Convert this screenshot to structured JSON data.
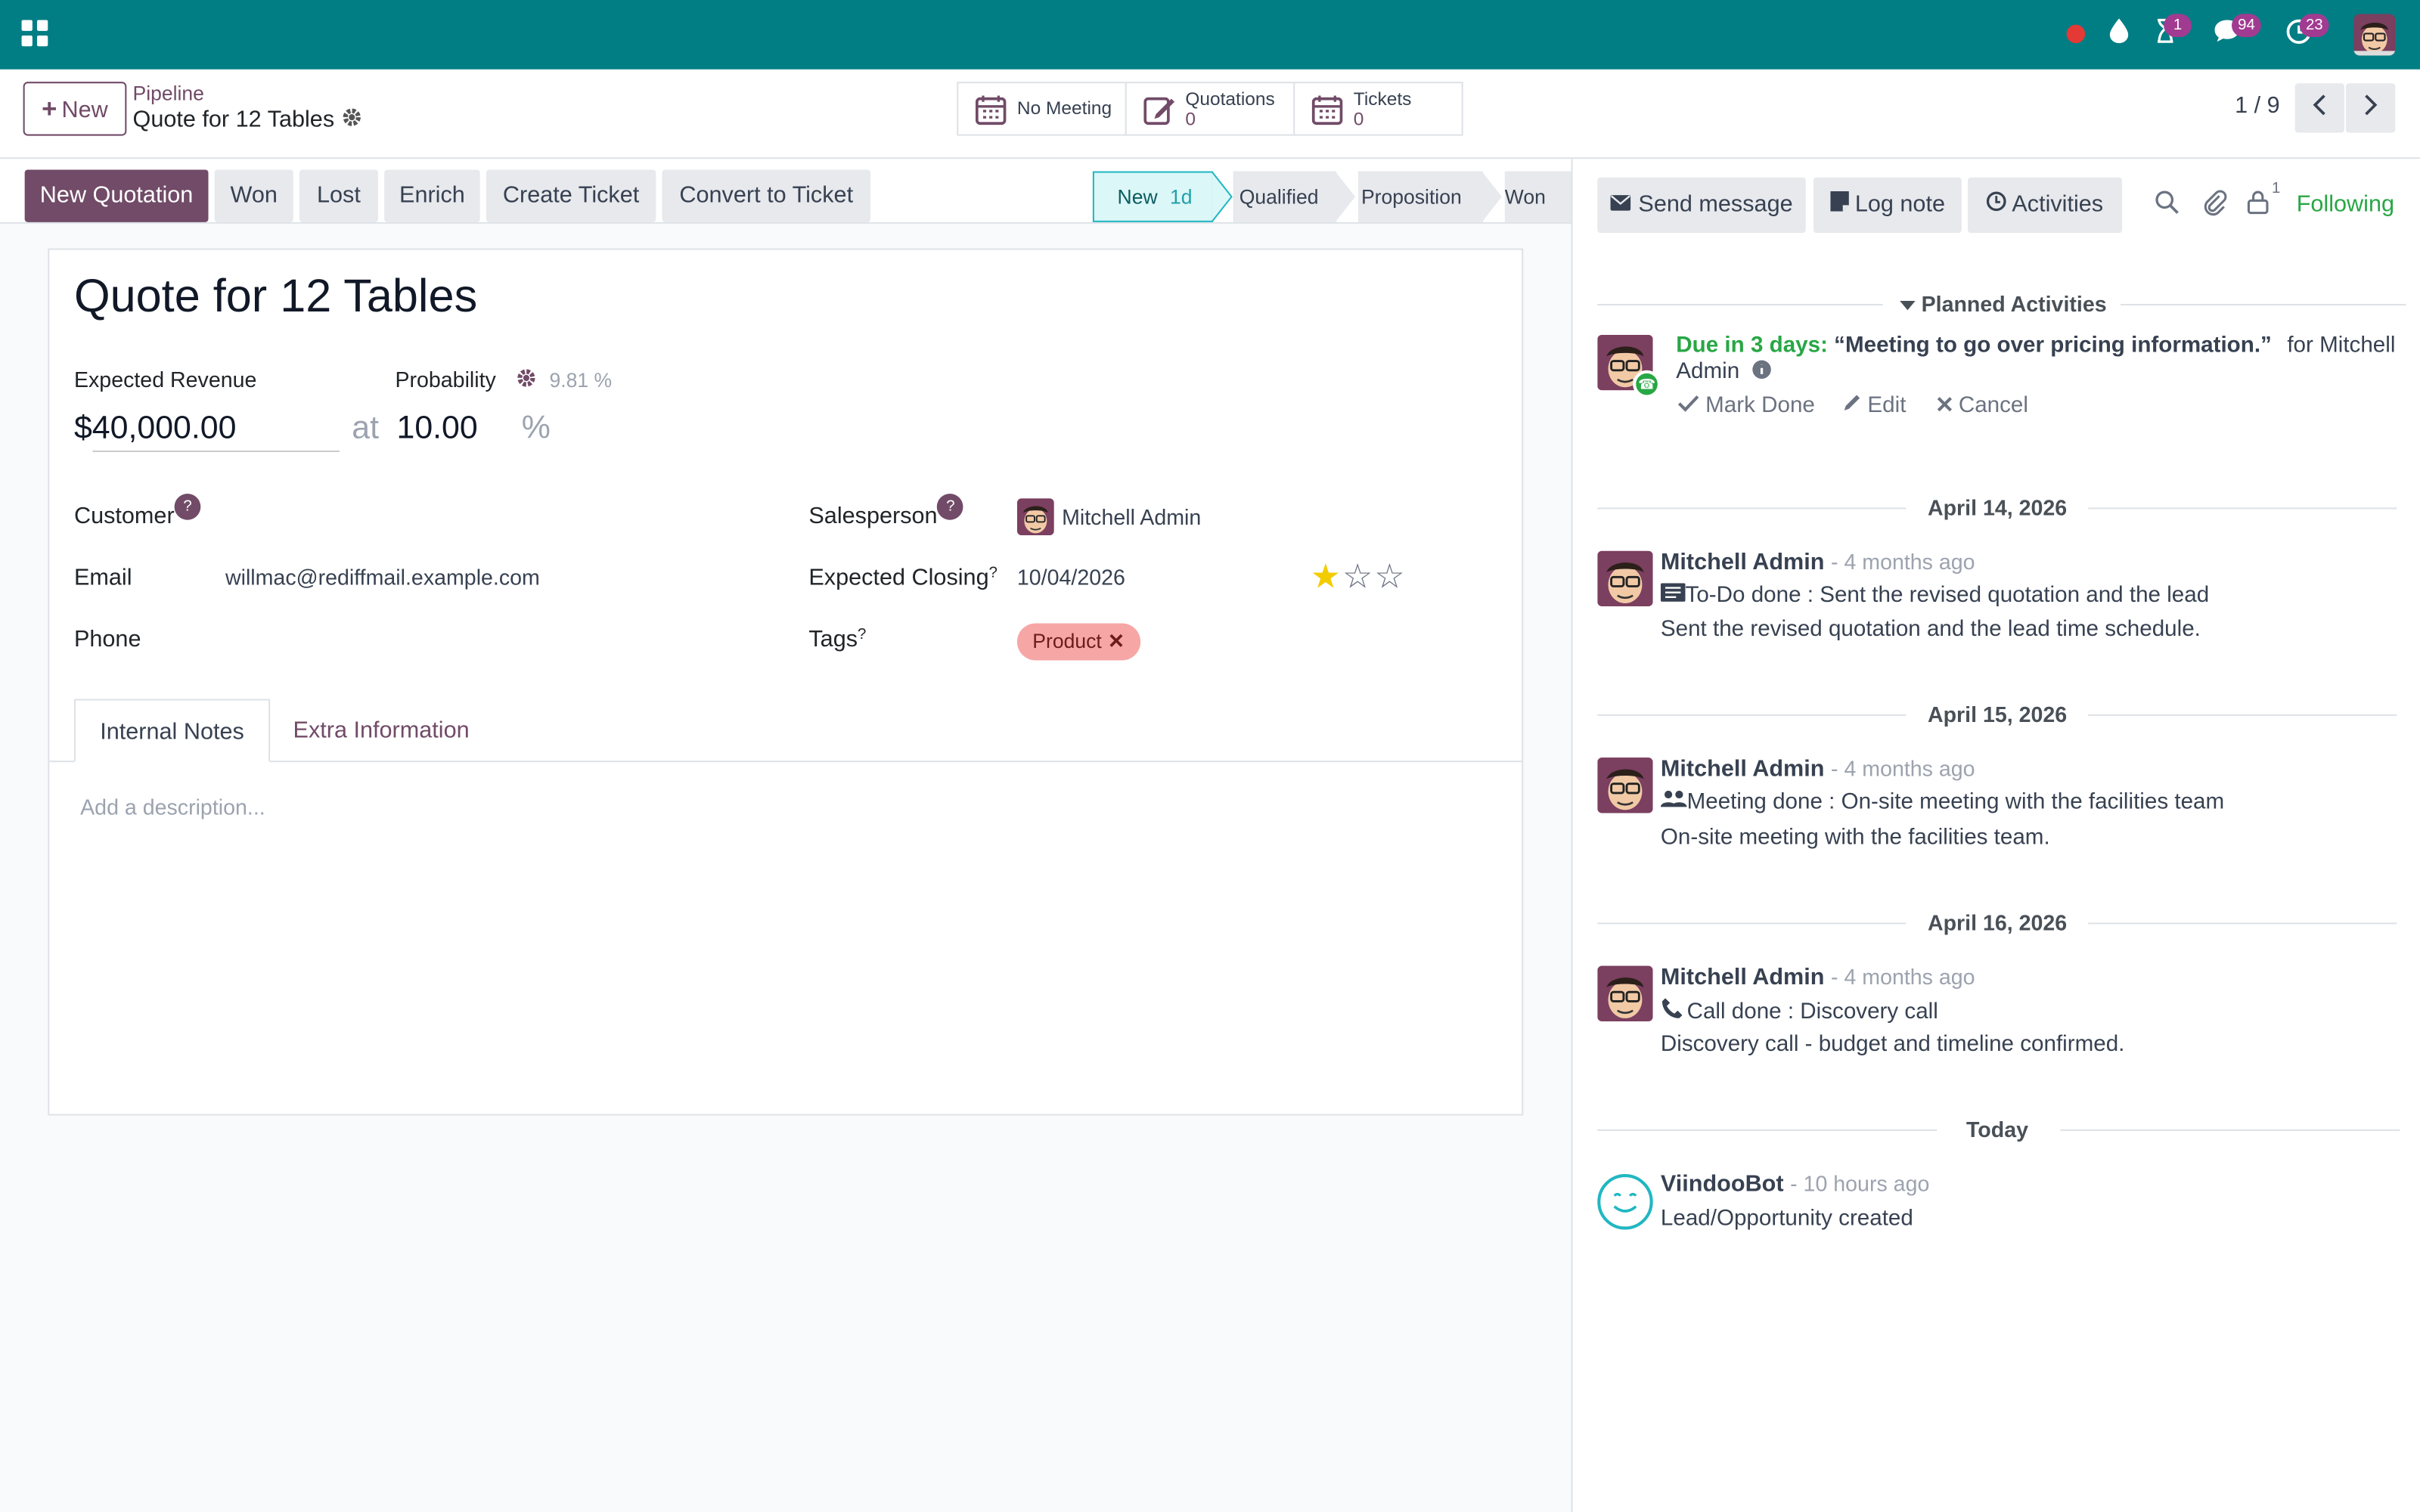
{
  "topbar": {
    "activity_count": "1",
    "messages_count": "94",
    "clock_count": "23"
  },
  "control_panel": {
    "new_label": "New",
    "breadcrumb_parent": "Pipeline",
    "breadcrumb_current": "Quote for 12 Tables",
    "smart_buttons": [
      {
        "label": "No Meeting",
        "value": ""
      },
      {
        "label": "Quotations",
        "value": "0"
      },
      {
        "label": "Tickets",
        "value": "0"
      }
    ],
    "pager": "1 / 9"
  },
  "actions": {
    "new_quotation": "New Quotation",
    "won": "Won",
    "lost": "Lost",
    "enrich": "Enrich",
    "create_ticket": "Create Ticket",
    "convert_to_ticket": "Convert to Ticket"
  },
  "stages": {
    "items": [
      "New",
      "Qualified",
      "Proposition",
      "Won"
    ],
    "active_duration": "1d",
    "active": "New"
  },
  "form": {
    "title": "Quote for 12 Tables",
    "expected_revenue_label": "Expected Revenue",
    "probability_label": "Probability",
    "probability_auto": "9.81 %",
    "expected_revenue": "$40,000.00",
    "at_label": "at",
    "probability_value": "10.00",
    "percent_sign": "%",
    "customer_label": "Customer",
    "email_label": "Email",
    "email_value": "willmac@rediffmail.example.com",
    "phone_label": "Phone",
    "salesperson_label": "Salesperson",
    "salesperson_value": "Mitchell Admin",
    "expected_closing_label": "Expected Closing",
    "expected_closing_value": "10/04/2026",
    "priority_stars": 1,
    "tags_label": "Tags",
    "tag_value": "Product",
    "tabs": [
      "Internal Notes",
      "Extra Information"
    ],
    "description_placeholder": "Add a description..."
  },
  "chatter": {
    "send_message": "Send message",
    "log_note": "Log note",
    "activities": "Activities",
    "follower_count": "1",
    "following": "Following",
    "planned_activities": "Planned Activities",
    "planned": {
      "due": "Due in 3 days:",
      "summary": "“Meeting to go over pricing information.”",
      "for_text": "for Mitchell",
      "assignee_rest": "Admin",
      "mark_done": "Mark Done",
      "edit": "Edit",
      "cancel": "Cancel"
    },
    "messages": [
      {
        "date": "April 14, 2026",
        "author": "Mitchell Admin",
        "time": "- 4 months ago",
        "title": "To-Do done : Sent the revised quotation and the lead",
        "body": "Sent the revised quotation and the lead time schedule."
      },
      {
        "date": "April 15, 2026",
        "author": "Mitchell Admin",
        "time": "- 4 months ago",
        "title": "Meeting done : On-site meeting with the facilities team",
        "body": "On-site meeting with the facilities team."
      },
      {
        "date": "April 16, 2026",
        "author": "Mitchell Admin",
        "time": "- 4 months ago",
        "title": "Call done : Discovery call",
        "body": "Discovery call - budget and timeline confirmed."
      },
      {
        "date": "Today",
        "author": "ViindooBot",
        "time": "- 10 hours ago",
        "title": "",
        "body": "Lead/Opportunity created"
      }
    ]
  },
  "colors": {
    "topbar": "#017e84",
    "brand": "#714b67",
    "success": "#28a745",
    "stage_active": "#dcf7f8"
  }
}
